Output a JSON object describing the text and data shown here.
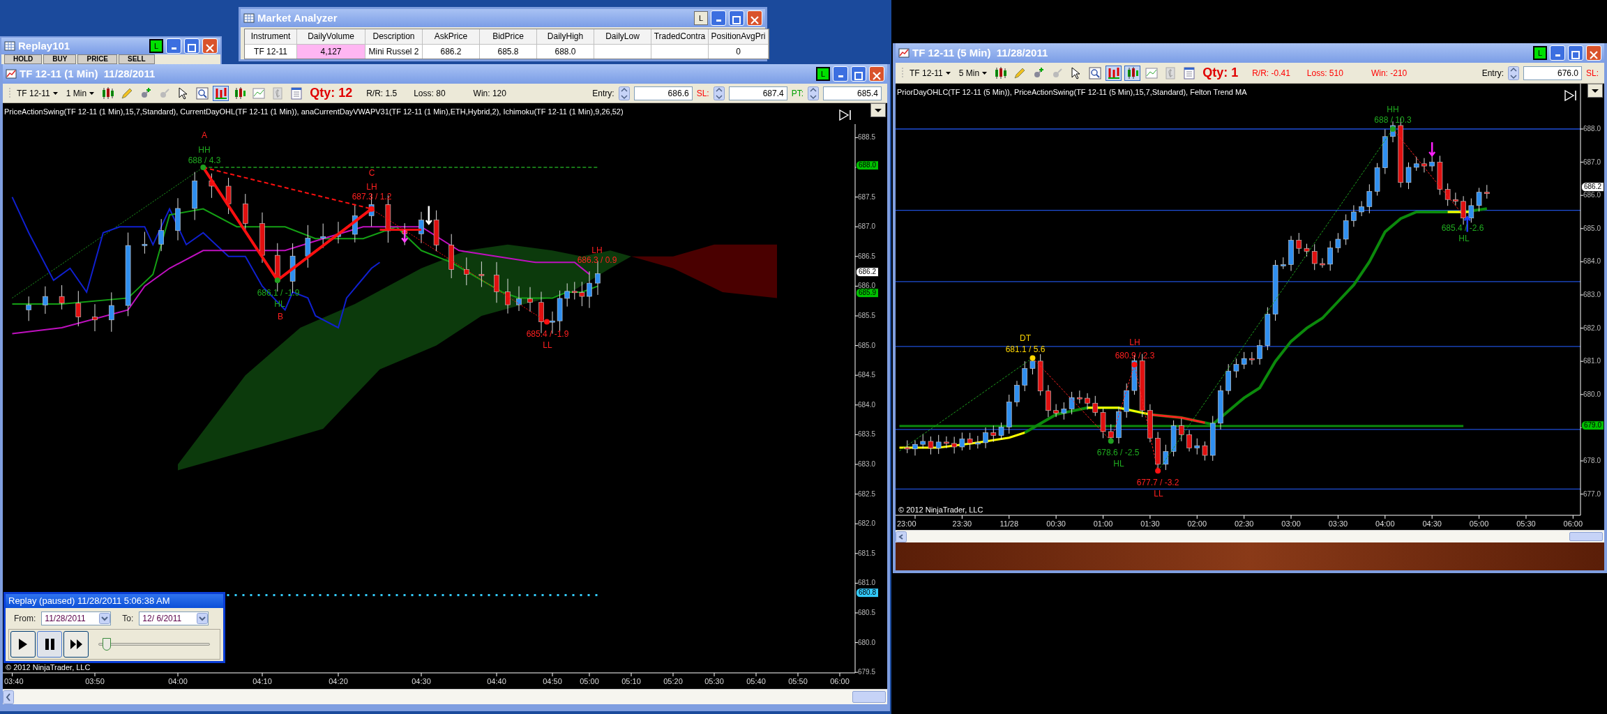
{
  "replay101": {
    "title": "Replay101",
    "link_button": "L",
    "columns": [
      "HOLD",
      "BUY",
      "PRICE",
      "SELL"
    ]
  },
  "market_analyzer": {
    "title": "Market Analyzer",
    "link_button": "L",
    "columns": [
      {
        "label": "Instrument",
        "value": "TF 12-11",
        "highlighted": false
      },
      {
        "label": "DailyVolume",
        "value": "4,127",
        "highlighted": true
      },
      {
        "label": "Description",
        "value": "Mini Russel 2",
        "highlighted": false
      },
      {
        "label": "AskPrice",
        "value": "686.2",
        "highlighted": false
      },
      {
        "label": "BidPrice",
        "value": "685.8",
        "highlighted": false
      },
      {
        "label": "DailyHigh",
        "value": "688.0",
        "highlighted": false
      },
      {
        "label": "DailyLow",
        "highlighted": false
      },
      {
        "label": "TradedContra",
        "highlighted": false
      },
      {
        "label": "PositionAvgPri",
        "value": "0",
        "highlighted": false
      }
    ]
  },
  "charts": [
    {
      "title": "TF 12-11 (1 Min)  11/28/2011",
      "link_button": "L",
      "instrument": "TF 12-11",
      "interval": "1 Min",
      "qty": "Qty: 12",
      "stats": [
        {
          "text": "R/R: 1.5",
          "color": "#000000"
        },
        {
          "text": "Loss: 80",
          "color": "#000000"
        },
        {
          "text": "Win: 120",
          "color": "#000000"
        }
      ],
      "fields": [
        {
          "label": "Entry:",
          "value": "686.6",
          "color": "#000000"
        },
        {
          "label": "SL:",
          "value": "687.4",
          "color": "#ff0000"
        },
        {
          "label": "PT:",
          "value": "685.4",
          "color": "#00a000"
        }
      ],
      "indicators": "PriceActionSwing(TF 12-11 (1 Min),15,7,Standard), CurrentDayOHL(TF 12-11 (1 Min)), anaCurrentDayVWAPV31(TF 12-11 (1 Min),ETH,Hybrid,2),  Ichimoku(TF 12-11 (1 Min),9,26,52)",
      "y_labels": [
        "688.5",
        "687.5",
        "687.0",
        "686.5",
        "686.0",
        "685.5",
        "685.0",
        "684.5",
        "684.0",
        "683.5",
        "683.0",
        "682.5",
        "682.0",
        "681.5",
        "681.0",
        "680.5",
        "680.0",
        "679.5"
      ],
      "price_tags": [
        {
          "text": "688.0",
          "color": "#00c000"
        },
        {
          "text": "686.2",
          "color": "#ffffff"
        },
        {
          "text": "685.9",
          "color": "#00c000"
        },
        {
          "text": "680.8",
          "color": "#33ccff"
        }
      ],
      "x_labels": [
        "03:40",
        "03:50",
        "04:00",
        "04:10",
        "04:20",
        "04:30",
        "04:40",
        "04:50",
        "05:00",
        "05:10",
        "05:20",
        "05:30",
        "05:40",
        "05:50",
        "06:00"
      ],
      "annotations": [
        {
          "text": "A",
          "color": "#ff2020"
        },
        {
          "text": "HH",
          "color": "#1faa1f"
        },
        {
          "text": "688 / 4.3",
          "color": "#1faa1f"
        },
        {
          "text": "C",
          "color": "#ff2020"
        },
        {
          "text": "LH",
          "color": "#ff2020"
        },
        {
          "text": "687.3 / 1.2",
          "color": "#ff2020"
        },
        {
          "text": "686.1 / -1.9",
          "color": "#1faa1f"
        },
        {
          "text": "HL",
          "color": "#1faa1f"
        },
        {
          "text": "B",
          "color": "#ff2020"
        },
        {
          "text": "685.4 / -1.9",
          "color": "#ff2020"
        },
        {
          "text": "LL",
          "color": "#ff2020"
        },
        {
          "text": "LH",
          "color": "#ff2020"
        },
        {
          "text": "686.3 / 0.9",
          "color": "#ff2020"
        }
      ],
      "copyright": "© 2012 NinjaTrader, LLC"
    },
    {
      "title": "TF 12-11 (5 Min)  11/28/2011",
      "link_button": "L",
      "instrument": "TF 12-11",
      "interval": "5 Min",
      "qty": "Qty: 1",
      "stats": [
        {
          "text": "R/R: -0.41",
          "color": "#ff0000"
        },
        {
          "text": "Loss: 510",
          "color": "#ff0000"
        },
        {
          "text": "Win: -210",
          "color": "#ff0000"
        }
      ],
      "fields": [
        {
          "label": "Entry:",
          "value": "676.0",
          "color": "#000000"
        },
        {
          "label": "SL:",
          "color": "#ff0000"
        }
      ],
      "indicators": "PriorDayOHLC(TF 12-11 (5 Min)), PriceActionSwing(TF 12-11 (5 Min),15,7,Standard), Felton Trend MA",
      "y_labels": [
        "688.0",
        "687.0",
        "686.0",
        "685.0",
        "684.0",
        "683.0",
        "682.0",
        "681.0",
        "680.0",
        "678.0",
        "677.0"
      ],
      "price_tags": [
        {
          "text": "686.2",
          "color": "#ffffff"
        },
        {
          "text": "679.0",
          "color": "#00c000"
        }
      ],
      "x_labels": [
        "23:00",
        "23:30",
        "11/28",
        "00:30",
        "01:00",
        "01:30",
        "02:00",
        "02:30",
        "03:00",
        "03:30",
        "04:00",
        "04:30",
        "05:00",
        "05:30",
        "06:00"
      ],
      "annotations": [
        {
          "text": "HH",
          "color": "#1faa1f"
        },
        {
          "text": "688 / 10.3",
          "color": "#1faa1f"
        },
        {
          "text": "685.4 / -2.6",
          "color": "#1faa1f"
        },
        {
          "text": "HL",
          "color": "#1faa1f"
        },
        {
          "text": "DT",
          "color": "#ffd700"
        },
        {
          "text": "681.1 / 5.6",
          "color": "#ffd700"
        },
        {
          "text": "LH",
          "color": "#ff2020"
        },
        {
          "text": "680.9 / 2.3",
          "color": "#ff2020"
        },
        {
          "text": "678.6 / -2.5",
          "color": "#1faa1f"
        },
        {
          "text": "HL",
          "color": "#1faa1f"
        },
        {
          "text": "677.7 / -3.2",
          "color": "#ff2020"
        },
        {
          "text": "LL",
          "color": "#ff2020"
        }
      ],
      "copyright": "© 2012 NinjaTrader, LLC"
    }
  ],
  "replay": {
    "title": "Replay (paused) 11/28/2011 5:06:38 AM",
    "from_label": "From:",
    "from": "11/28/2011",
    "to_label": "To:",
    "to": "12/ 6/2011",
    "buttons": [
      {
        "kind": "play",
        "selected": false
      },
      {
        "kind": "pause",
        "selected": true
      },
      {
        "kind": "fast_forward",
        "selected": false
      }
    ],
    "speed": {
      "level": 0.04
    }
  }
}
